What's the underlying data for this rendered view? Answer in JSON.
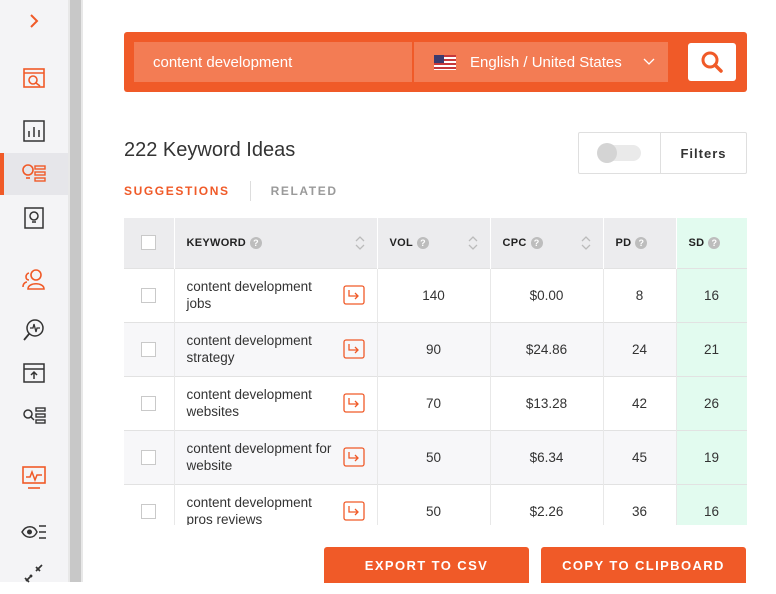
{
  "search": {
    "value": "content development",
    "language": "English / United States"
  },
  "heading": "222 Keyword Ideas",
  "filters_label": "Filters",
  "tabs": [
    "SUGGESTIONS",
    "RELATED"
  ],
  "columns": {
    "keyword": "KEYWORD",
    "vol": "VOL",
    "cpc": "CPC",
    "pd": "PD",
    "sd": "SD"
  },
  "rows": [
    {
      "keyword": "content development jobs",
      "vol": "140",
      "cpc": "$0.00",
      "pd": "8",
      "sd": "16"
    },
    {
      "keyword": "content development strategy",
      "vol": "90",
      "cpc": "$24.86",
      "pd": "24",
      "sd": "21"
    },
    {
      "keyword": "content development websites",
      "vol": "70",
      "cpc": "$13.28",
      "pd": "42",
      "sd": "26"
    },
    {
      "keyword": "content development for website",
      "vol": "50",
      "cpc": "$6.34",
      "pd": "45",
      "sd": "19"
    },
    {
      "keyword": "content development pros reviews",
      "vol": "50",
      "cpc": "$2.26",
      "pd": "36",
      "sd": "16"
    }
  ],
  "buttons": {
    "export": "EXPORT TO CSV",
    "copy": "COPY TO CLIPBOARD"
  },
  "colors": {
    "accent": "#f05a28",
    "sd_bg": "#e2fbef"
  },
  "sidebar_icons": [
    "expand-chevron-icon",
    "keyword-overview-icon",
    "chart-icon",
    "keyword-ideas-icon",
    "content-ideas-icon",
    "users-icon",
    "site-audit-icon",
    "rank-tracker-icon",
    "backlinks-icon",
    "traffic-analyzer-icon",
    "visibility-icon",
    "link-icon"
  ]
}
